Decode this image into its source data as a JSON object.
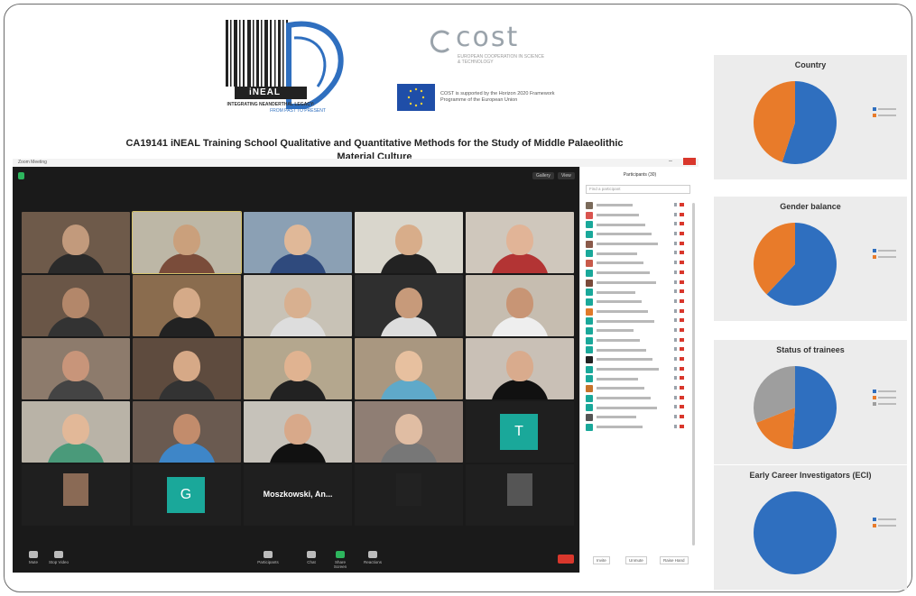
{
  "header": {
    "ineal_logo_text": "iNEAL",
    "ineal_tagline": "INTEGRATING NEANDERTHAL LEGACY:",
    "ineal_tagline2": "FROM PAST TO PRESENT",
    "cost_word": "cost",
    "cost_sub": "EUROPEAN COOPERATION IN SCIENCE & TECHNOLOGY",
    "eu_text": "COST is supported by the Horizon 2020 Framework Programme of the European Union",
    "title": "CA19141 iNEAL Training School Qualitative and Quantitative Methods for the Study of Middle Palaeolithic Material Culture",
    "colors": {
      "eu_blue": "#1f4ea8",
      "cost_gray": "#9aa3ab"
    }
  },
  "zoom": {
    "titlebar": "Zoom Meeting",
    "top_buttons": [
      "Gallery",
      "View"
    ],
    "grid": [
      {
        "name": "",
        "type": "video",
        "bg": "#6e5a4a",
        "face": "#c29a7c",
        "shirt": "#2a2a2a"
      },
      {
        "name": "",
        "type": "video",
        "bg": "#bdb7a6",
        "face": "#caa07c",
        "shirt": "#7a4c3a",
        "highlight": true
      },
      {
        "name": "",
        "type": "video",
        "bg": "#8ba0b4",
        "face": "#e0b898",
        "shirt": "#2f4a7d"
      },
      {
        "name": "",
        "type": "video",
        "bg": "#d9d6cc",
        "face": "#d8ad8a",
        "shirt": "#222"
      },
      {
        "name": "",
        "type": "video",
        "bg": "#cfc7bc",
        "face": "#e1b497",
        "shirt": "#b33434"
      },
      {
        "name": "",
        "type": "video",
        "bg": "#6a5647",
        "face": "#b3876a",
        "shirt": "#333"
      },
      {
        "name": "",
        "type": "video",
        "bg": "#8a6c4e",
        "face": "#d5aa88",
        "shirt": "#222"
      },
      {
        "name": "",
        "type": "video",
        "bg": "#c8c2b6",
        "face": "#d8b090",
        "shirt": "#ddd"
      },
      {
        "name": "",
        "type": "video",
        "bg": "#2f2f2f",
        "face": "#c79a7a",
        "shirt": "#ddd"
      },
      {
        "name": "",
        "type": "video",
        "bg": "#c6bdb0",
        "face": "#c89575",
        "shirt": "#eee"
      },
      {
        "name": "",
        "type": "video",
        "bg": "#8d7b6c",
        "face": "#c8957a",
        "shirt": "#444"
      },
      {
        "name": "",
        "type": "video",
        "bg": "#5e4b3e",
        "face": "#d6a987",
        "shirt": "#333"
      },
      {
        "name": "",
        "type": "video",
        "bg": "#b4a78e",
        "face": "#e0b391",
        "shirt": "#222"
      },
      {
        "name": "",
        "type": "video",
        "bg": "#a99780",
        "face": "#e7c09f",
        "shirt": "#5fa9c9"
      },
      {
        "name": "",
        "type": "video",
        "bg": "#c9c0b6",
        "face": "#d9ab8d",
        "shirt": "#111"
      },
      {
        "name": "",
        "type": "video",
        "bg": "#b9b3a7",
        "face": "#e2b898",
        "shirt": "#4a9a7a"
      },
      {
        "name": "",
        "type": "video",
        "bg": "#6a5a50",
        "face": "#c28c6c",
        "shirt": "#3e86c8"
      },
      {
        "name": "",
        "type": "video",
        "bg": "#c6c2ba",
        "face": "#d8a98a",
        "shirt": "#111"
      },
      {
        "name": "",
        "type": "video",
        "bg": "#8f7e74",
        "face": "#e0bda3",
        "shirt": "#777"
      },
      {
        "name": "",
        "type": "letter",
        "letter": "T"
      },
      {
        "name": "",
        "type": "thumb",
        "thumb_color": "#8a6a55"
      },
      {
        "name": "",
        "type": "letter",
        "letter": "G"
      },
      {
        "name": "",
        "type": "namecard",
        "text": "Moszkowski, An..."
      },
      {
        "name": "",
        "type": "thumb",
        "thumb_color": "#222"
      },
      {
        "name": "",
        "type": "thumb",
        "thumb_color": "#555"
      }
    ],
    "bottom_bar": [
      {
        "label": "Mute",
        "icon": "microphone-icon"
      },
      {
        "label": "Stop Video",
        "icon": "video-icon"
      },
      {
        "label": "Participants",
        "icon": "participants-icon"
      },
      {
        "label": "Chat",
        "icon": "chat-icon"
      },
      {
        "label": "Share Screen",
        "icon": "share-screen-icon",
        "accent": true
      },
      {
        "label": "Reactions",
        "icon": "reactions-icon"
      }
    ]
  },
  "participants_panel": {
    "header": "Participants (30)",
    "search_placeholder": "Find a participant",
    "footer_buttons": [
      "Invite",
      "Unmute",
      "Raise Hand"
    ],
    "avatar_colors": [
      "#7a6a5a",
      "#d9544f",
      "#1aa89a",
      "#1aa89a",
      "#8a5a4a",
      "#1aa89a",
      "#c85a4a",
      "#1aa89a",
      "#7a4a3a",
      "#1aa89a",
      "#1aa89a",
      "#e07a2a",
      "#1aa89a",
      "#1aa89a",
      "#1aa89a",
      "#1aa89a",
      "#222",
      "#1aa89a",
      "#1aa89a",
      "#c8732a",
      "#1aa89a",
      "#1aa89a",
      "#555",
      "#1aa89a"
    ]
  },
  "charts": [
    {
      "title": "Country",
      "type": "pie",
      "slices": [
        {
          "value": 55,
          "color": "#2f6fbf"
        },
        {
          "value": 45,
          "color": "#e87b2a"
        }
      ],
      "legend_colors": [
        "#2f6fbf",
        "#e87b2a"
      ]
    },
    {
      "title": "Gender balance",
      "type": "pie",
      "slices": [
        {
          "value": 62,
          "color": "#2f6fbf"
        },
        {
          "value": 38,
          "color": "#e87b2a"
        }
      ],
      "legend_colors": [
        "#2f6fbf",
        "#e87b2a"
      ]
    },
    {
      "title": "Status of trainees",
      "type": "pie",
      "slices": [
        {
          "value": 51,
          "color": "#2f6fbf"
        },
        {
          "value": 18,
          "color": "#e87b2a"
        },
        {
          "value": 31,
          "color": "#9e9e9e"
        }
      ],
      "legend_colors": [
        "#2f6fbf",
        "#e87b2a",
        "#9e9e9e"
      ]
    },
    {
      "title": "Early Career Investigators (ECI)",
      "type": "pie",
      "slices": [
        {
          "value": 100,
          "color": "#2f6fbf"
        }
      ],
      "legend_colors": [
        "#2f6fbf",
        "#e87b2a"
      ]
    }
  ],
  "chart_data": [
    {
      "type": "pie",
      "title": "Country",
      "values": [
        55,
        45
      ]
    },
    {
      "type": "pie",
      "title": "Gender balance",
      "values": [
        62,
        38
      ]
    },
    {
      "type": "pie",
      "title": "Status of trainees",
      "values": [
        51,
        18,
        31
      ]
    },
    {
      "type": "pie",
      "title": "Early Career Investigators (ECI)",
      "values": [
        100
      ]
    }
  ]
}
